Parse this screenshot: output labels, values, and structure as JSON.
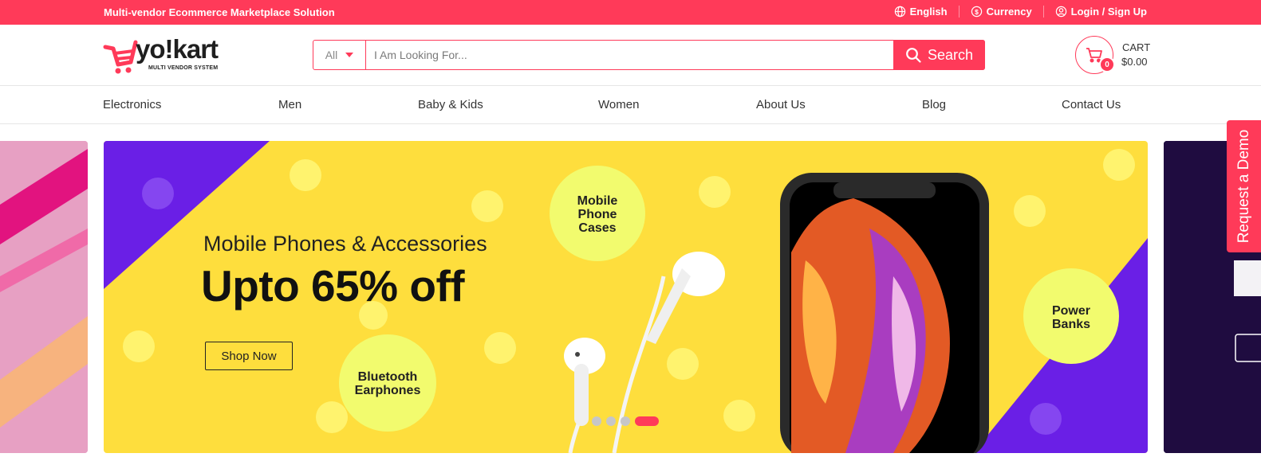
{
  "topbar": {
    "promo": "Multi-vendor Ecommerce Marketplace Solution",
    "language": "English",
    "currency": "Currency",
    "login": "Login / Sign Up",
    "bg_color": "#ff3a59"
  },
  "logo": {
    "name": "yo!kart",
    "tagline": "MULTI VENDOR SYSTEM"
  },
  "search": {
    "category": "All",
    "placeholder": "I Am Looking For...",
    "button": "Search"
  },
  "cart": {
    "label": "CART",
    "total": "$0.00",
    "count": "0"
  },
  "nav": [
    "Electronics",
    "Men",
    "Baby & Kids",
    "Women",
    "About Us",
    "Blog",
    "Contact Us"
  ],
  "banner": {
    "subtitle": "Mobile Phones & Accessories",
    "title": "Upto 65% off",
    "cta": "Shop Now",
    "bubbles": [
      "Mobile Phone Cases",
      "Bluetooth Earphones",
      "Power Banks"
    ],
    "slide_count": 4,
    "active_slide": 4,
    "bg_color": "#fede3d",
    "accent_color": "#6a1fe6"
  },
  "side_tab": "Request a Demo"
}
